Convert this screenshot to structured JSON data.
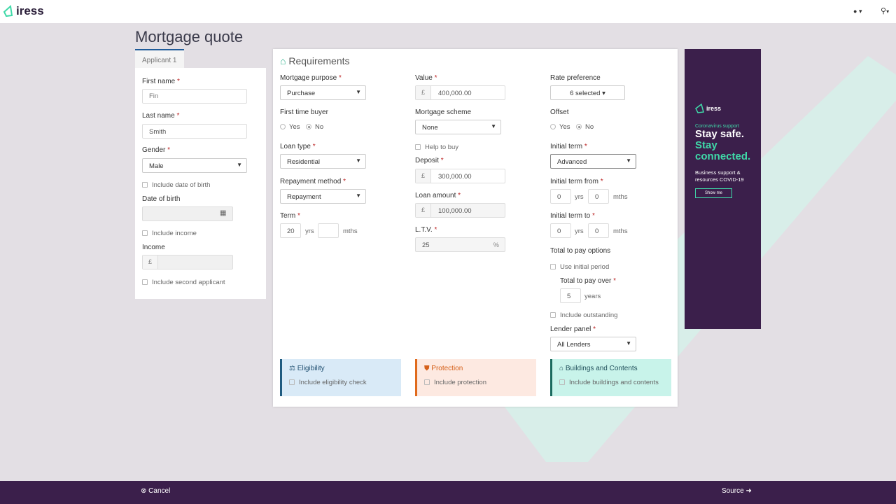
{
  "app": {
    "logo": "iress",
    "user_icon": "user-icon",
    "search_icon": "search-icon"
  },
  "page": {
    "title": "Mortgage quote",
    "tab": "Applicant 1"
  },
  "applicant": {
    "first_name_label": "First name",
    "first_name_placeholder": "Fin",
    "last_name_label": "Last name",
    "last_name_value": "Smith",
    "gender_label": "Gender",
    "gender_value": "Male",
    "include_dob": "Include date of birth",
    "dob_label": "Date of birth",
    "include_income": "Include income",
    "income_label": "Income",
    "currency": "£",
    "include_second": "Include second applicant"
  },
  "requirements": {
    "title": "Requirements",
    "mortgage_purpose_label": "Mortgage purpose",
    "mortgage_purpose": "Purchase",
    "first_time_buyer_label": "First time buyer",
    "yes": "Yes",
    "no": "No",
    "loan_type_label": "Loan type",
    "loan_type": "Residential",
    "repayment_label": "Repayment method",
    "repayment": "Repayment",
    "term_label": "Term",
    "term_years": "20",
    "yrs": "yrs",
    "mths": "mths",
    "value_label": "Value",
    "value": "400,000.00",
    "scheme_label": "Mortgage scheme",
    "scheme": "None",
    "help_to_buy": "Help to buy",
    "deposit_label": "Deposit",
    "deposit": "300,000.00",
    "loan_amount_label": "Loan amount",
    "loan_amount": "100,000.00",
    "ltv_label": "L.T.V.",
    "ltv": "25",
    "percent": "%",
    "rate_pref_label": "Rate preference",
    "rate_pref": "6 selected",
    "offset_label": "Offset",
    "initial_term_label": "Initial term",
    "initial_term": "Advanced",
    "initial_from_label": "Initial term from",
    "from_yrs": "0",
    "from_mths": "0",
    "initial_to_label": "Initial term to",
    "to_yrs": "0",
    "to_mths": "0",
    "total_options_label": "Total to pay options",
    "use_initial": "Use initial period",
    "total_over_label": "Total to pay over",
    "total_over": "5",
    "years": "years",
    "include_outstanding": "Include outstanding",
    "lender_panel_label": "Lender panel",
    "lender_panel": "All Lenders"
  },
  "boxes": {
    "eligibility_title": "Eligibility",
    "eligibility_check": "Include eligibility check",
    "protection_title": "Protection",
    "protection_check": "Include protection",
    "buildings_title": "Buildings and Contents",
    "buildings_check": "Include buildings and contents"
  },
  "ad": {
    "logo": "iress",
    "kicker": "Coronavirus support",
    "line1": "Stay safe.",
    "line2": "Stay connected.",
    "body": "Business support & resources COVID-19",
    "button": "Show me"
  },
  "footer": {
    "cancel": "Cancel",
    "source": "Source"
  },
  "colors": {
    "purple": "#3b1f4b",
    "teal": "#3fd9a8",
    "eligibility": "#d9eaf7",
    "protection": "#fde9e1",
    "buildings": "#c8f3ea"
  }
}
